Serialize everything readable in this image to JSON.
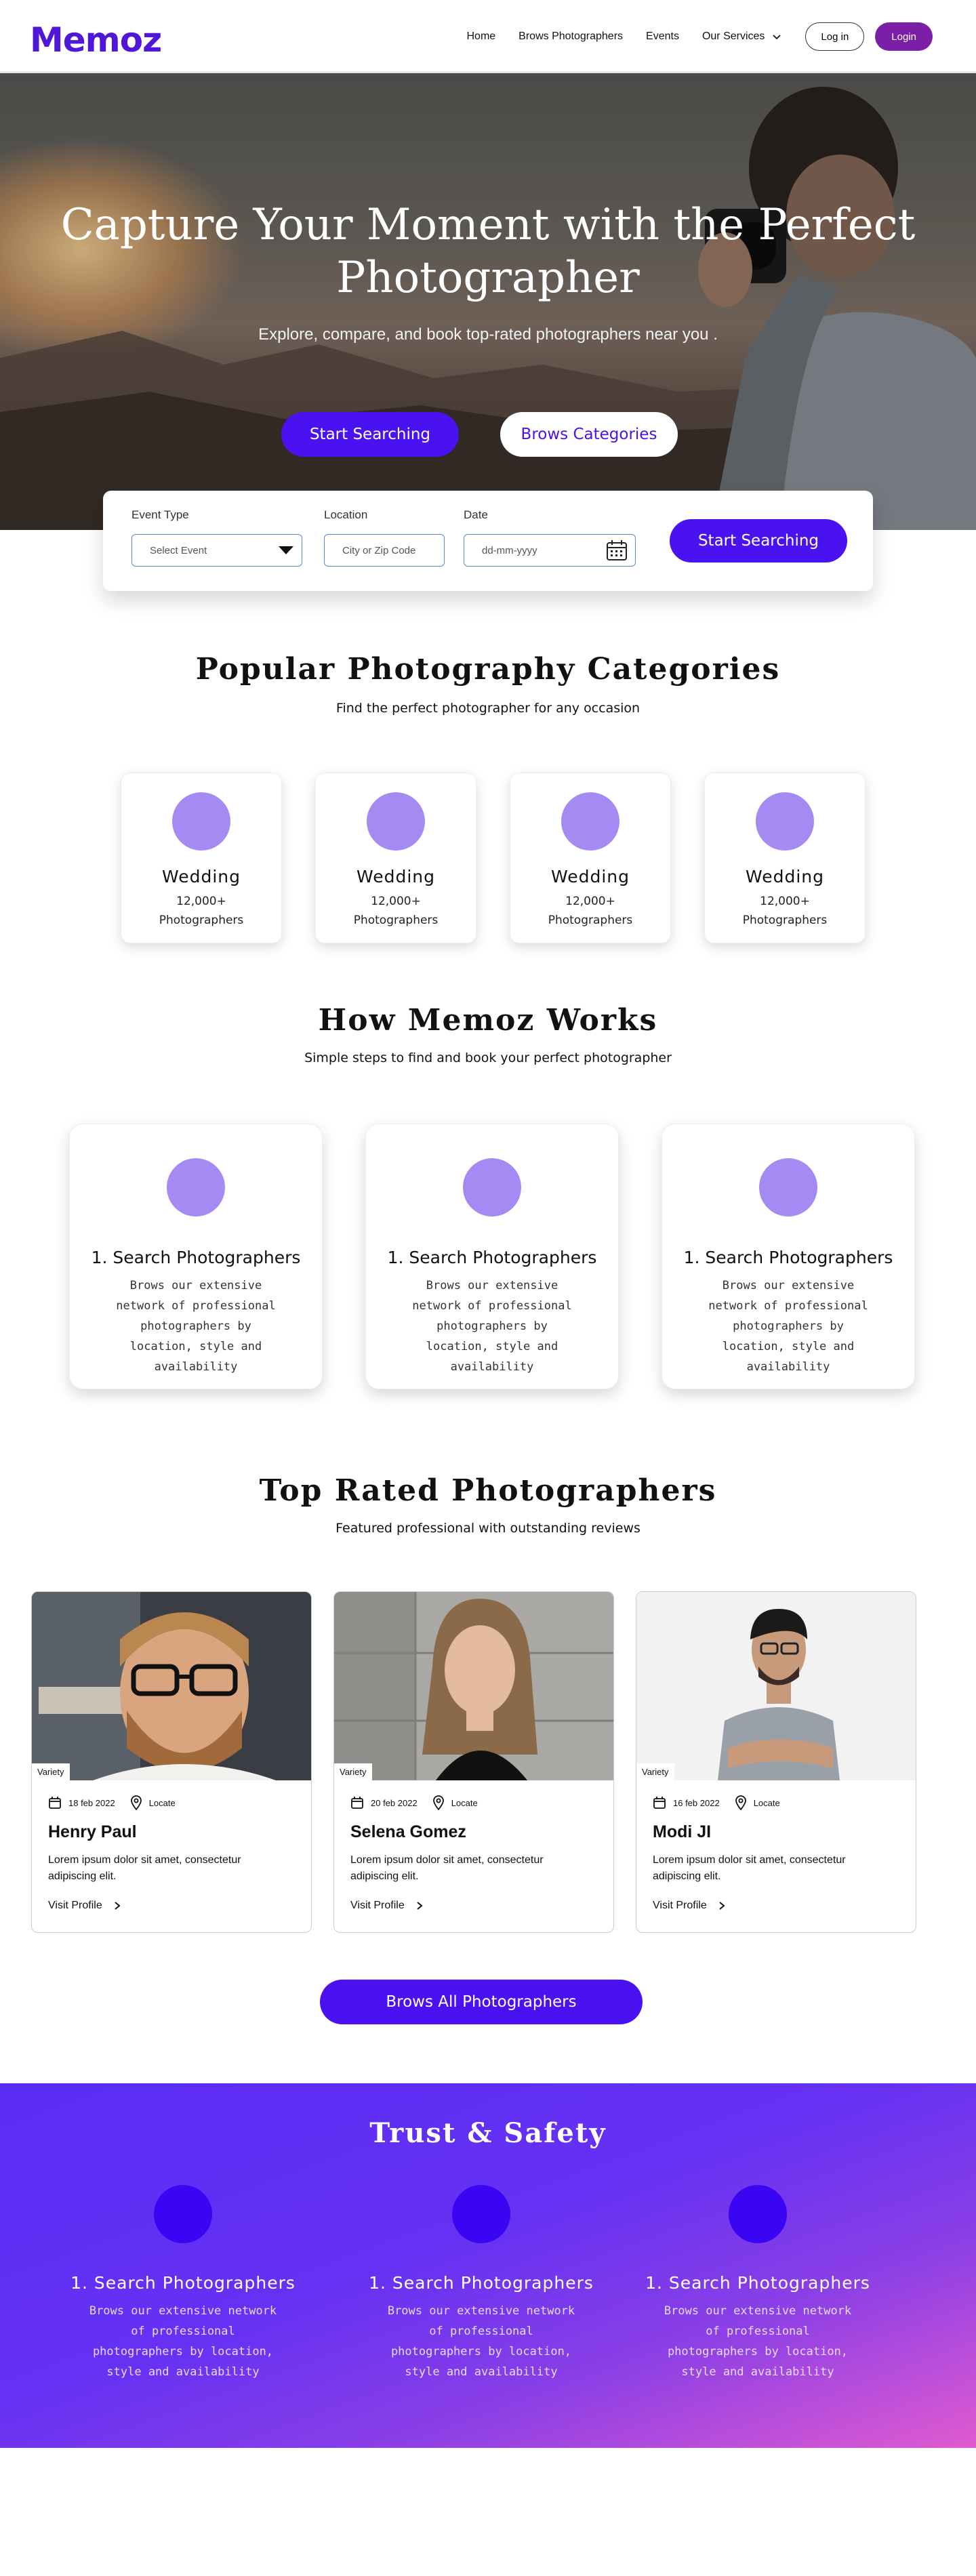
{
  "nav": {
    "logo": "Memoz",
    "links": [
      "Home",
      "Brows Photographers",
      "Events",
      "Our Services"
    ],
    "log_in": "Log in",
    "login": "Login"
  },
  "hero": {
    "title": "Capture Your Moment with the Perfect Photographer",
    "subtitle": "Explore, compare, and book top-rated photographers near you .",
    "primary_button": "Start Searching",
    "secondary_button": "Brows Categories"
  },
  "search": {
    "event_label": "Event Type",
    "event_value": "Select Event",
    "location_label": "Location",
    "location_placeholder": "City or Zip Code",
    "date_label": "Date",
    "date_placeholder": "dd-mm-yyyy",
    "button": "Start Searching"
  },
  "categories": {
    "title": "Popular Photography Categories",
    "subtitle": "Find the perfect photographer for any occasion",
    "items": [
      {
        "name": "Wedding",
        "count": "12,000+ Photographers"
      },
      {
        "name": "Wedding",
        "count": "12,000+ Photographers"
      },
      {
        "name": "Wedding",
        "count": "12,000+ Photographers"
      },
      {
        "name": "Wedding",
        "count": "12,000+ Photographers"
      }
    ]
  },
  "how": {
    "title": "How Memoz Works",
    "subtitle": "Simple steps to find and book your perfect photographer",
    "steps": [
      {
        "title": "1. Search Photographers",
        "desc": "Brows our extensive network of professional photographers by location, style and availability"
      },
      {
        "title": "1. Search Photographers",
        "desc": "Brows our extensive network of professional photographers by location, style and availability"
      },
      {
        "title": "1. Search Photographers",
        "desc": "Brows our extensive network of professional photographers by location, style and availability"
      }
    ]
  },
  "top_rated": {
    "title": "Top Rated Photographers",
    "subtitle": "Featured professional with outstanding reviews",
    "cards": [
      {
        "badge": "Variety",
        "date": "18 feb 2022",
        "locate": "Locate",
        "name": "Henry Paul",
        "desc": "Lorem ipsum dolor sit amet, consectetur adipiscing elit.",
        "link": "Visit Profile"
      },
      {
        "badge": "Variety",
        "date": "20 feb 2022",
        "locate": "Locate",
        "name": "Selena Gomez",
        "desc": "Lorem ipsum dolor sit amet, consectetur adipiscing elit.",
        "link": "Visit Profile"
      },
      {
        "badge": "Variety",
        "date": "16 feb 2022",
        "locate": "Locate",
        "name": "Modi JI",
        "desc": "Lorem ipsum dolor sit amet, consectetur adipiscing elit.",
        "link": "Visit Profile"
      }
    ],
    "all_button": "Brows All Photographers"
  },
  "trust": {
    "title": "Trust & Safety",
    "items": [
      {
        "title": "1. Search Photographers",
        "desc": "Brows our extensive network of professional photographers by location, style and availability"
      },
      {
        "title": "1. Search Photographers",
        "desc": "Brows our extensive network of professional photographers by location, style and availability"
      },
      {
        "title": "1. Search Photographers",
        "desc": "Brows our extensive network of professional photographers by location, style and availability"
      }
    ]
  },
  "colors": {
    "brand": "#4f17d8",
    "primary_button": "#4a12f0",
    "login_button": "#7b1fa6",
    "category_circle": "#a58af3",
    "trust_circle": "#3a05f2"
  },
  "icons": [
    "chevron-down-icon",
    "dropdown-arrow-icon",
    "calendar-icon",
    "location-pin-icon",
    "chevron-right-icon"
  ]
}
